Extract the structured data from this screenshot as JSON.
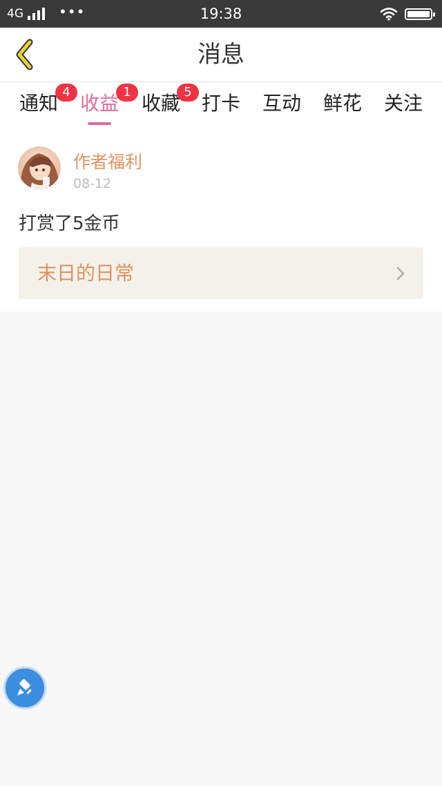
{
  "status_bar": {
    "network": "4G",
    "time": "19:38",
    "dots": "•••"
  },
  "header": {
    "title": "消息",
    "back_icon": "chevron-left-icon",
    "accent_color": "#e6d23a"
  },
  "tabs": [
    {
      "label": "通知",
      "badge": "4",
      "active": false
    },
    {
      "label": "收益",
      "badge": "1",
      "active": true
    },
    {
      "label": "收藏",
      "badge": "5",
      "active": false
    },
    {
      "label": "打卡",
      "badge": "",
      "active": false
    },
    {
      "label": "互动",
      "badge": "",
      "active": false
    },
    {
      "label": "鲜花",
      "badge": "",
      "active": false
    },
    {
      "label": "关注",
      "badge": "",
      "active": false
    }
  ],
  "message": {
    "author": "作者福利",
    "date": "08-12",
    "text": "打赏了5金币",
    "book_title": "末日的日常",
    "book_icon": "chevron-right-icon"
  },
  "colors": {
    "active_tab": "#e06b9c",
    "badge": "#ee3344",
    "author": "#e0925f",
    "float_button": "#3b8ee0"
  },
  "float_button": {
    "icon": "brush-icon"
  }
}
